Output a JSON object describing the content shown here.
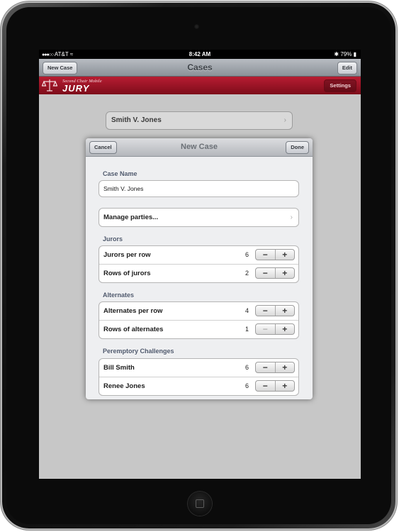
{
  "status_bar": {
    "carrier": "AT&T",
    "time": "8:42 AM",
    "battery": "79%"
  },
  "nav_bar": {
    "left_button": "New Case",
    "title": "Cases",
    "right_button": "Edit"
  },
  "brand_bar": {
    "tagline": "Second Chair Mobile",
    "product": "JURY",
    "settings_button": "Settings"
  },
  "case_list": [
    {
      "name": "Smith V. Jones"
    }
  ],
  "modal": {
    "title": "New Case",
    "cancel_label": "Cancel",
    "done_label": "Done",
    "case_name_header": "Case Name",
    "case_name_value": "Smith V. Jones",
    "manage_parties_label": "Manage parties...",
    "jurors_header": "Jurors",
    "jurors": [
      {
        "label": "Jurors per row",
        "value": "6"
      },
      {
        "label": "Rows of jurors",
        "value": "2"
      }
    ],
    "alternates_header": "Alternates",
    "alternates": [
      {
        "label": "Alternates per row",
        "value": "4"
      },
      {
        "label": "Rows of alternates",
        "value": "1"
      }
    ],
    "challenges_header": "Peremptory Challenges",
    "challenges": [
      {
        "label": "Bill Smith",
        "value": "6"
      },
      {
        "label": "Renee Jones",
        "value": "6"
      }
    ],
    "stepper_minus": "−",
    "stepper_plus": "+"
  }
}
